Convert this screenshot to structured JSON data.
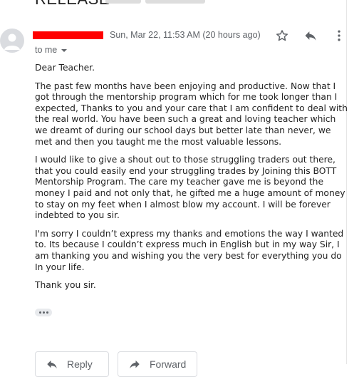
{
  "header": {
    "subject": "RELEASE"
  },
  "message": {
    "date": "Sun, Mar 22, 11:53 AM (20 hours ago)",
    "recipient_label": "to me",
    "greeting": "Dear Teacher.",
    "paragraphs": [
      "The past few months have been enjoying and productive. Now that I got through the mentorship program which for me took longer than I expected, Thanks to you and your care that I am confident to deal with the real world. You have been such a great and loving teacher which we dreamt of during our school days but better late than never, we met and then you taught me the most valuable lessons.",
      "I would like to give a shout out to those struggling traders out there, that you could easily end your struggling trades by Joining this BOTT Mentorship Program. The care my teacher gave me is beyond the money I paid and not only that, he gifted me a huge amount of money to stay on my feet when I almost blow my account. I will be forever indebted to you sir.",
      "I'm sorry I couldn’t express my thanks and emotions the way I wanted to. Its because I couldn’t express much in English but in my way Sir, I am thanking you and wishing you the very best for everything you do In your life."
    ],
    "closing": "Thank you sir."
  },
  "icons": {
    "star": "star-icon",
    "reply": "reply-icon",
    "more": "more-vert-icon",
    "avatar": "person-icon"
  },
  "actions": {
    "reply_label": "Reply",
    "forward_label": "Forward"
  },
  "colors": {
    "redaction": "#ff0000",
    "secondary_text": "#5f6368"
  }
}
